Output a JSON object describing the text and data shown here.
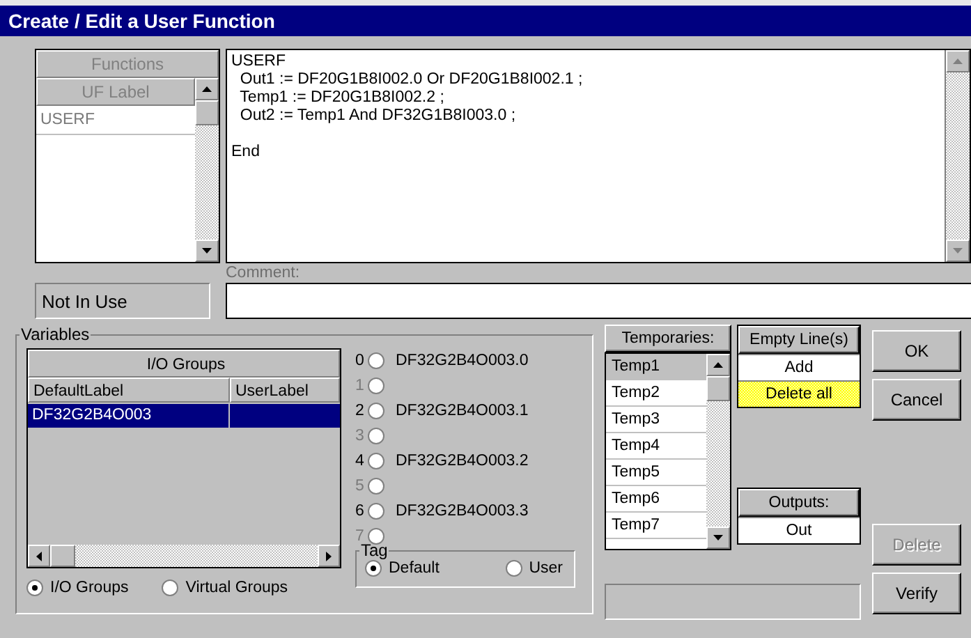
{
  "window": {
    "title": "Create / Edit a User Function"
  },
  "functions": {
    "header": "Functions",
    "column": "UF Label",
    "items": [
      {
        "label": "USERF",
        "disabled": true
      }
    ]
  },
  "editor": {
    "lines": [
      {
        "kind": "code",
        "text": "USERF"
      },
      {
        "kind": "code",
        "text": "  Out1 := DF20G1B8I002.0 Or DF20G1B8I002.1 ;"
      },
      {
        "kind": "code",
        "text": "  Temp1 := DF20G1B8I002.2 ;"
      },
      {
        "kind": "code",
        "text": "  Out2 := Temp1 And DF32G1B8I003.0 ;"
      },
      {
        "kind": "blank"
      },
      {
        "kind": "code",
        "text": "End"
      }
    ]
  },
  "status": "Not In Use",
  "comment": {
    "label": "Comment:"
  },
  "variables": {
    "title": "Variables",
    "table": {
      "title": "I/O Groups",
      "columns": [
        "DefaultLabel",
        "UserLabel"
      ],
      "rows": [
        {
          "default_label": "DF32G2B4O003",
          "selected": true
        }
      ]
    },
    "group_mode": [
      {
        "label": "I/O Groups",
        "selected": true
      },
      {
        "label": "Virtual Groups",
        "selected": false
      }
    ],
    "bits": [
      {
        "number": "0",
        "label": "DF32G2B4O003.0",
        "disabled": false,
        "selected": false
      },
      {
        "number": "1",
        "disabled": true,
        "selected": false
      },
      {
        "number": "2",
        "label": "DF32G2B4O003.1",
        "disabled": false,
        "selected": false
      },
      {
        "number": "3",
        "disabled": true,
        "selected": false
      },
      {
        "number": "4",
        "label": "DF32G2B4O003.2",
        "disabled": false,
        "selected": false
      },
      {
        "number": "5",
        "disabled": true,
        "selected": false
      },
      {
        "number": "6",
        "label": "DF32G2B4O003.3",
        "disabled": false,
        "selected": false
      },
      {
        "number": "7",
        "disabled": true,
        "selected": false
      }
    ],
    "tag": {
      "title": "Tag",
      "options": [
        {
          "label": "Default",
          "selected": true
        },
        {
          "label": "User",
          "selected": false
        }
      ]
    }
  },
  "temporaries": {
    "header": "Temporaries:",
    "items": [
      {
        "label": "Temp1",
        "selected": true
      },
      {
        "label": "Temp2",
        "selected": false
      },
      {
        "label": "Temp3",
        "selected": false
      },
      {
        "label": "Temp4",
        "selected": false
      },
      {
        "label": "Temp5",
        "selected": false
      },
      {
        "label": "Temp6",
        "selected": false
      },
      {
        "label": "Temp7",
        "selected": false
      }
    ]
  },
  "empty_lines": {
    "header": "Empty Line(s)",
    "actions": [
      {
        "label": "Add",
        "highlighted": false
      },
      {
        "label": "Delete all",
        "highlighted": true
      }
    ]
  },
  "outputs": {
    "header": "Outputs:",
    "items": [
      "Out"
    ]
  },
  "buttons": [
    {
      "label": "OK",
      "disabled": false
    },
    {
      "label": "Cancel",
      "disabled": false
    },
    {
      "label": "Delete",
      "disabled": true
    },
    {
      "label": "Verify",
      "disabled": false
    }
  ]
}
